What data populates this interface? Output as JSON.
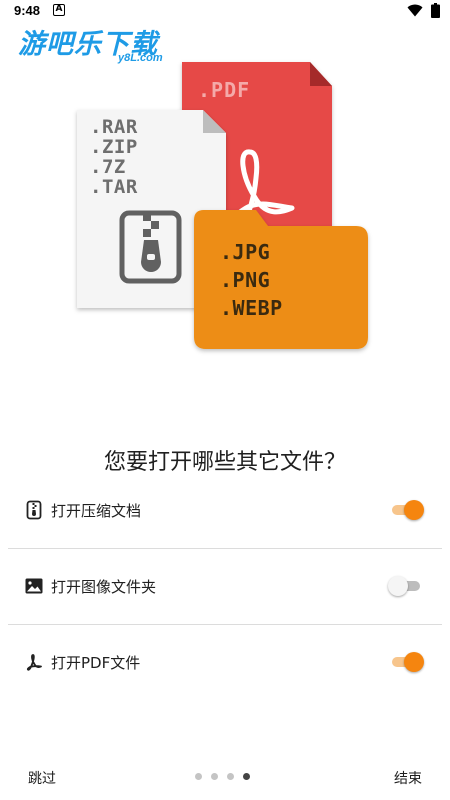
{
  "status_bar": {
    "time": "9:48",
    "notification_icon": "A",
    "icons": [
      "wifi-icon",
      "battery-icon"
    ]
  },
  "watermark": {
    "main": "游吧乐下载",
    "sub": "y8L.com"
  },
  "illustration": {
    "pdf_ext": ".PDF",
    "archive_exts": [
      ".RAR",
      ".ZIP",
      ".7Z",
      ".TAR"
    ],
    "image_exts": [
      ".JPG",
      ".PNG",
      ".WEBP"
    ],
    "colors": {
      "pdf": "#e64a47",
      "folder": "#ed8d12",
      "archive": "#f5f5f5"
    }
  },
  "question": "您要打开哪些其它文件？",
  "options": [
    {
      "label": "打开压缩文档",
      "icon": "archive-file-icon",
      "enabled": true
    },
    {
      "label": "打开图像文件夹",
      "icon": "image-icon",
      "enabled": false
    },
    {
      "label": "打开PDF文件",
      "icon": "pdf-acrobat-icon",
      "enabled": true
    }
  ],
  "footer": {
    "skip_label": "跳过",
    "done_label": "结束",
    "page_count": 4,
    "current_page": 4
  },
  "accent_color": "#f5850f"
}
